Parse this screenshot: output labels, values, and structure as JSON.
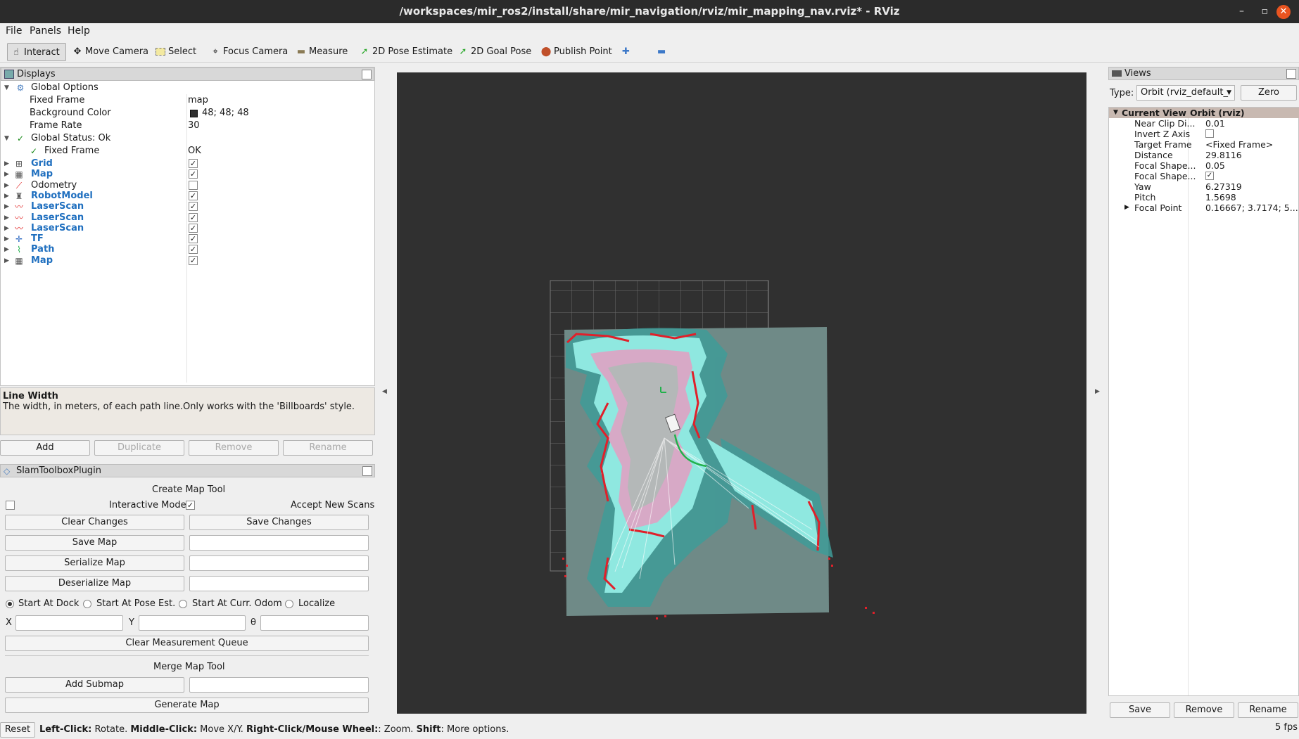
{
  "window": {
    "title": "/workspaces/mir_ros2/install/share/mir_navigation/rviz/mir_mapping_nav.rviz* - RViz"
  },
  "menu": [
    "File",
    "Panels",
    "Help"
  ],
  "toolbar": {
    "tools": [
      {
        "label": "Interact",
        "icon": "hand-icon",
        "active": true
      },
      {
        "label": "Move Camera",
        "icon": "move-camera-icon"
      },
      {
        "label": "Select",
        "icon": "select-icon"
      },
      {
        "label": "Focus Camera",
        "icon": "focus-camera-icon"
      },
      {
        "label": "Measure",
        "icon": "measure-icon"
      },
      {
        "label": "2D Pose Estimate",
        "icon": "pose-arrow-icon"
      },
      {
        "label": "2D Goal Pose",
        "icon": "goal-arrow-icon"
      },
      {
        "label": "Publish Point",
        "icon": "map-pin-icon"
      }
    ]
  },
  "displays": {
    "title": "Displays",
    "global_options": {
      "label": "Global Options",
      "fixed_frame": {
        "key": "Fixed Frame",
        "value": "map"
      },
      "background_color": {
        "key": "Background Color",
        "value": "48; 48; 48",
        "swatch": "#303030"
      },
      "frame_rate": {
        "key": "Frame Rate",
        "value": "30"
      }
    },
    "global_status": {
      "label": "Global Status: Ok",
      "fixed_frame": {
        "key": "Fixed Frame",
        "value": "OK"
      }
    },
    "items": [
      {
        "label": "Grid",
        "checked": true,
        "icon": "grid-icon"
      },
      {
        "label": "Map",
        "checked": true,
        "icon": "map-icon"
      },
      {
        "label": "Odometry",
        "checked": false,
        "icon": "odometry-icon"
      },
      {
        "label": "RobotModel",
        "checked": true,
        "icon": "robot-icon"
      },
      {
        "label": "LaserScan",
        "checked": true,
        "icon": "laserscan-icon"
      },
      {
        "label": "LaserScan",
        "checked": true,
        "icon": "laserscan-icon"
      },
      {
        "label": "LaserScan",
        "checked": true,
        "icon": "laserscan-icon"
      },
      {
        "label": "TF",
        "checked": true,
        "icon": "tf-icon"
      },
      {
        "label": "Path",
        "checked": true,
        "icon": "path-icon"
      },
      {
        "label": "Map",
        "checked": true,
        "icon": "map-icon"
      }
    ],
    "description": {
      "title": "Line Width",
      "text": "The width, in meters, of each path line.Only works with the 'Billboards' style."
    },
    "buttons": {
      "add": "Add",
      "duplicate": "Duplicate",
      "remove": "Remove",
      "rename": "Rename"
    }
  },
  "slam": {
    "title": "SlamToolboxPlugin",
    "create_title": "Create Map Tool",
    "interactive_mode": "Interactive Mode",
    "interactive_checked": false,
    "accept_new_scans": "Accept New Scans",
    "accept_checked": true,
    "clear_changes": "Clear Changes",
    "save_changes": "Save Changes",
    "save_map": "Save Map",
    "serialize_map": "Serialize Map",
    "deserialize_map": "Deserialize Map",
    "radios": [
      "Start At Dock",
      "Start At Pose Est.",
      "Start At Curr. Odom",
      "Localize"
    ],
    "radio_selected": "Start At Dock",
    "x_label": "X",
    "y_label": "Y",
    "theta_label": "θ",
    "clear_queue": "Clear Measurement Queue",
    "merge_title": "Merge Map Tool",
    "add_submap": "Add Submap",
    "generate_map": "Generate Map"
  },
  "views": {
    "title": "Views",
    "type_label": "Type:",
    "type_value": "Orbit (rviz_default_",
    "zero": "Zero",
    "current_view": {
      "key": "Current View",
      "value": "Orbit (rviz)"
    },
    "rows": [
      {
        "key": "Near Clip Di...",
        "value": "0.01"
      },
      {
        "key": "Invert Z Axis",
        "value": "",
        "checkbox": false
      },
      {
        "key": "Target Frame",
        "value": "<Fixed Frame>"
      },
      {
        "key": "Distance",
        "value": "29.8116"
      },
      {
        "key": "Focal Shape...",
        "value": "0.05"
      },
      {
        "key": "Focal Shape...",
        "value": "",
        "checkbox": true
      },
      {
        "key": "Yaw",
        "value": "6.27319"
      },
      {
        "key": "Pitch",
        "value": "1.5698"
      },
      {
        "key": "Focal Point",
        "value": "0.16667; 3.7174; 5...",
        "expandable": true
      }
    ],
    "buttons": {
      "save": "Save",
      "remove": "Remove",
      "rename": "Rename"
    }
  },
  "status": {
    "reset": "Reset",
    "hint_parts": [
      {
        "b": "Left-Click:",
        "t": " Rotate. "
      },
      {
        "b": "Middle-Click:",
        "t": " Move X/Y. "
      },
      {
        "b": "Right-Click/Mouse Wheel:",
        "t": ": Zoom. "
      },
      {
        "b": "Shift",
        "t": ": More options."
      }
    ],
    "fps": "5 fps"
  },
  "colors": {
    "accent_blue": "#1f6fbf",
    "viewport_bg": "#303030",
    "map_gray": "#6f8a87",
    "costmap_cyan": "#8fe8e0",
    "obstacle_red": "#e0202a",
    "path_green": "#22b14c"
  }
}
